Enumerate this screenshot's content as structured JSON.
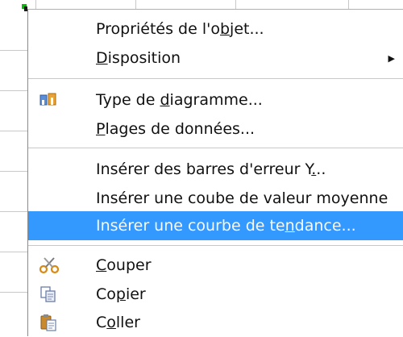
{
  "menu": {
    "group1": [
      {
        "label": "Propriétés de l'objet...",
        "mnemonic_index": 17
      },
      {
        "label": "Disposition",
        "mnemonic_index": 0,
        "has_submenu": true,
        "submenu_icon": "submenu-arrow-icon"
      }
    ],
    "group2": [
      {
        "label": "Type de diagramme...",
        "mnemonic_index": 8,
        "icon": "chart-type-icon"
      },
      {
        "label": "Plages de données...",
        "mnemonic_index": 0
      }
    ],
    "group3": [
      {
        "label": "Insérer des barres d'erreur Y...",
        "mnemonic_index": 29
      },
      {
        "label": "Insérer une coube de valeur moyenne",
        "mnemonic_index": -1
      },
      {
        "label": "Insérer une courbe de tendance...",
        "mnemonic_index": 24,
        "selected": true
      }
    ],
    "group4": [
      {
        "label": "Couper",
        "mnemonic_index": 0,
        "icon": "scissors-icon"
      },
      {
        "label": "Copier",
        "mnemonic_index": 2,
        "icon": "copy-icon"
      },
      {
        "label": "Coller",
        "mnemonic_index": 1,
        "icon": "paste-icon"
      }
    ]
  },
  "colors": {
    "selection": "#3399ff",
    "separator": "#c8c8c8",
    "text": "#111111"
  }
}
